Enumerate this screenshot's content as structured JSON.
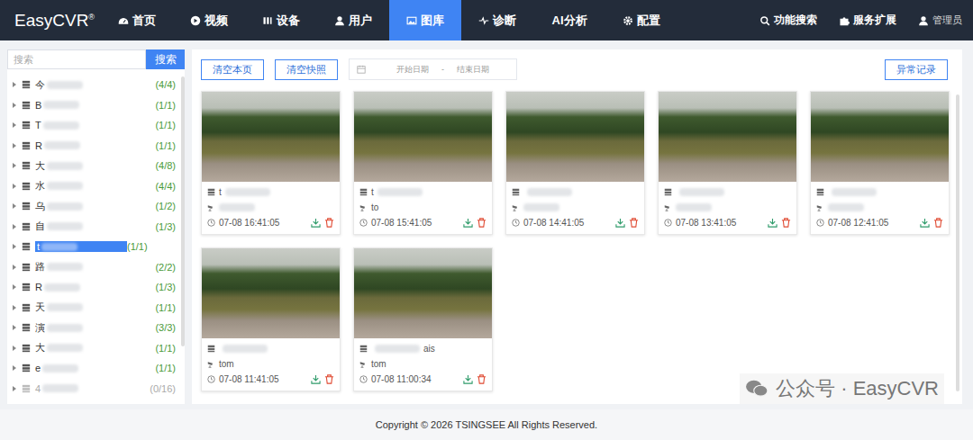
{
  "logo": {
    "text": "EasyCVR",
    "mark": "®"
  },
  "nav": [
    {
      "label": "首页",
      "selected": false
    },
    {
      "label": "视频",
      "selected": false
    },
    {
      "label": "设备",
      "selected": false
    },
    {
      "label": "用户",
      "selected": false
    },
    {
      "label": "图库",
      "selected": true
    },
    {
      "label": "诊断",
      "selected": false
    },
    {
      "label": "AI分析",
      "selected": false
    },
    {
      "label": "配置",
      "selected": false
    }
  ],
  "nav_right": [
    "功能搜索",
    "服务扩展"
  ],
  "user": "管理员",
  "sidebar": {
    "search_placeholder": "搜索",
    "search_button": "搜索",
    "items": [
      {
        "name": "今",
        "count": "(4/4)",
        "selected": false,
        "disabled": false
      },
      {
        "name": "B",
        "count": "(1/1)",
        "selected": false,
        "disabled": false
      },
      {
        "name": "T",
        "count": "(1/1)",
        "selected": false,
        "disabled": false
      },
      {
        "name": "R",
        "count": "(1/1)",
        "selected": false,
        "disabled": false
      },
      {
        "name": "大",
        "count": "(4/8)",
        "selected": false,
        "disabled": false
      },
      {
        "name": "水",
        "count": "(4/4)",
        "selected": false,
        "disabled": false
      },
      {
        "name": "乌",
        "count": "(1/2)",
        "selected": false,
        "disabled": false
      },
      {
        "name": "自",
        "count": "(1/3)",
        "selected": false,
        "disabled": false
      },
      {
        "name": "t",
        "count": "(1/1)",
        "selected": true,
        "disabled": false
      },
      {
        "name": "路",
        "count": "(2/2)",
        "selected": false,
        "disabled": false
      },
      {
        "name": "R",
        "count": "(1/3)",
        "selected": false,
        "disabled": false
      },
      {
        "name": "天",
        "count": "(1/1)",
        "selected": false,
        "disabled": false
      },
      {
        "name": "演",
        "count": "(3/3)",
        "selected": false,
        "disabled": false
      },
      {
        "name": "大",
        "count": "(1/1)",
        "selected": false,
        "disabled": false
      },
      {
        "name": "e",
        "count": "(1/1)",
        "selected": false,
        "disabled": false
      },
      {
        "name": "4",
        "count": "(0/16)",
        "selected": false,
        "disabled": true
      }
    ]
  },
  "toolbar": {
    "buttons": [
      "清空本页",
      "清空快照"
    ],
    "date_start": "开始日期",
    "date_separator": "-",
    "date_end": "结束日期",
    "record_button": "异常记录"
  },
  "snapshots": [
    {
      "device_prefix": "t",
      "device_suffix": "",
      "channel": "",
      "time": "07-08 16:41:05"
    },
    {
      "device_prefix": "t",
      "device_suffix": "",
      "channel": "to",
      "time": "07-08 15:41:05"
    },
    {
      "device_prefix": "",
      "device_suffix": "",
      "channel": "",
      "time": "07-08 14:41:05"
    },
    {
      "device_prefix": "",
      "device_suffix": "",
      "channel": "",
      "time": "07-08 13:41:05"
    },
    {
      "device_prefix": "",
      "device_suffix": "",
      "channel": "",
      "time": "07-08 12:41:05"
    },
    {
      "device_prefix": "",
      "device_suffix": "",
      "channel": "tom",
      "time": "07-08 11:41:05"
    },
    {
      "device_prefix": "",
      "device_suffix": "ais",
      "channel": "tom",
      "time": "07-08 11:00:34"
    }
  ],
  "watermark": "公众号 · EasyCVR",
  "footer": "Copyright © 2026 TSINGSEE All Rights Reserved."
}
